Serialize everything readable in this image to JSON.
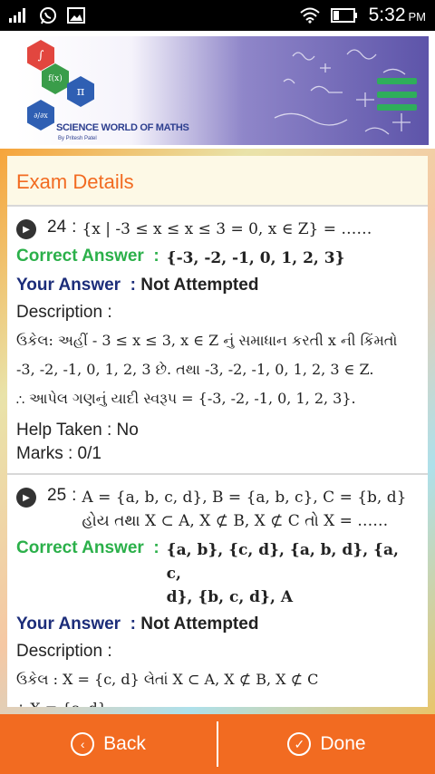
{
  "status_bar": {
    "time": "5:32",
    "ampm": "PM"
  },
  "banner": {
    "brand": "SCIENCE WORLD OF MATHS",
    "brand_sub": "By Pritesh Patel",
    "hex_symbols": [
      "∫",
      "f(x)",
      "π",
      "∂/∂x"
    ]
  },
  "exam": {
    "title": "Exam Details"
  },
  "questions": [
    {
      "number": "24",
      "sep": ":",
      "text": "{x | -3 ≤ x ≤ x ≤ 3 = 0, x ∈ Z} = ……",
      "correct_label": "Correct Answer  :",
      "correct_value": "{-3, -2, -1, 0, 1, 2, 3}",
      "your_label": "Your Answer  : ",
      "your_value": "Not Attempted",
      "description_label": "Description  :",
      "description_lines": [
        "ઉકેલ: અહીં - 3 ≤ x ≤ 3, x ∈ Z નું સમાધાન કરતી x ની કિંમતો",
        "-3, -2, -1, 0, 1, 2, 3 છે. તથા -3, -2, -1, 0, 1, 2, 3 ∈ Z.",
        "∴ આપેલ ગણનું યાદી સ્વરૂપ = {-3, -2, -1, 0, 1, 2, 3}."
      ],
      "help_label": "Help Taken  :  No",
      "marks_label": "Marks  :  0/1"
    },
    {
      "number": "25",
      "sep": ":",
      "text_lines": [
        "A = {a, b, c, d}, B = {a, b, c}, C = {b, d}",
        "હોય તથા X ⊂ A, X ⊄ B, X ⊄ C તો X = ……"
      ],
      "correct_label": "Correct Answer  :",
      "correct_value_lines": [
        "{a, b}, {c, d}, {a, b, d}, {a, c,",
        "d}, {b, c, d}, A"
      ],
      "your_label": "Your Answer  : ",
      "your_value": "Not Attempted",
      "description_label": "Description  :",
      "description_lines": [
        "ઉકેલ : X = {c, d} લેતાં X ⊂ A, X ⊄ B, X ⊄ C",
        "∴ X = {c, d}"
      ]
    }
  ],
  "bottom_bar": {
    "back_label": "Back",
    "done_label": "Done"
  },
  "colors": {
    "accent": "#f26b21",
    "correct": "#2bb04a",
    "your_answer": "#1c2d7a"
  }
}
